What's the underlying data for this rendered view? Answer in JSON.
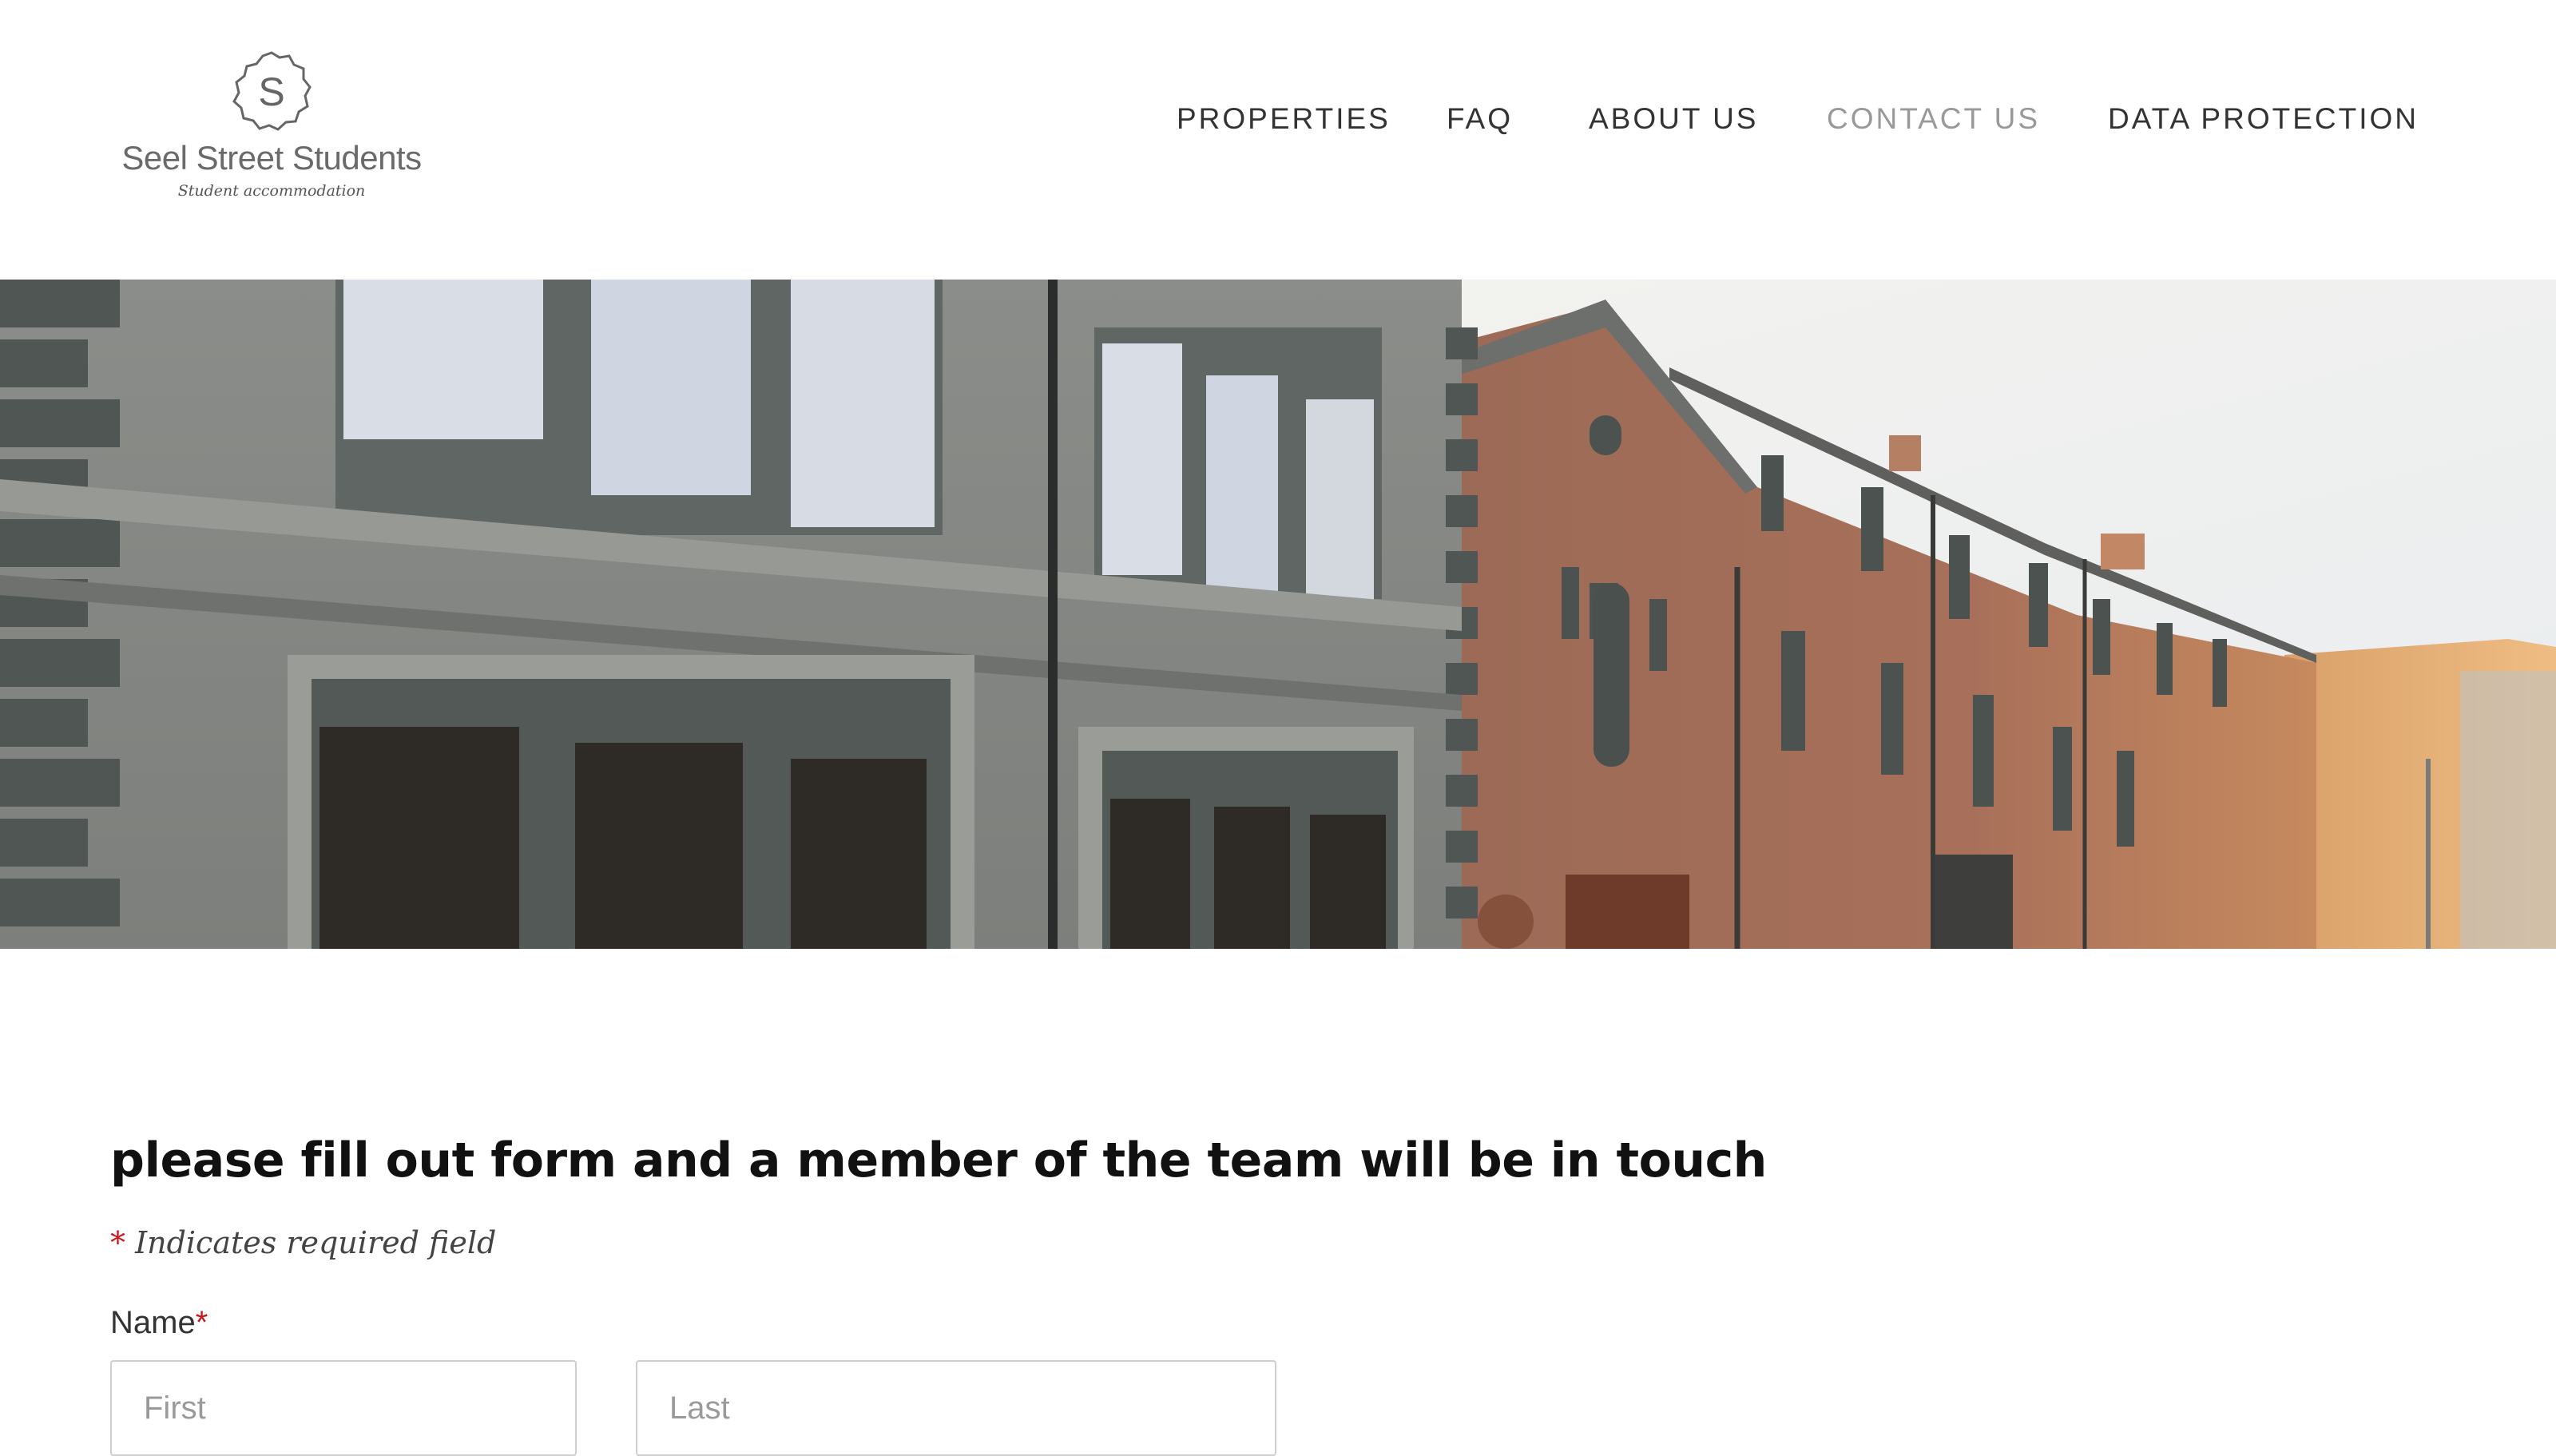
{
  "header": {
    "logo": {
      "monogram": "S",
      "name": "Seel Street Students",
      "tagline": "Student accommodation"
    },
    "nav": [
      {
        "label": "PROPERTIES",
        "active": false
      },
      {
        "label": "FAQ",
        "active": false
      },
      {
        "label": "ABOUT US",
        "active": false
      },
      {
        "label": "CONTACT US",
        "active": true
      },
      {
        "label": "DATA PROTECTION",
        "active": false
      }
    ]
  },
  "hero": {
    "image": "street-of-terraced-buildings-photo"
  },
  "form": {
    "title": "please fill out form and a member of the team will be in touch",
    "required_marker": "*",
    "required_note": "Indicates required field",
    "name_label": "Name",
    "first_placeholder": "First",
    "last_placeholder": "Last"
  },
  "colors": {
    "nav_text": "#333333",
    "nav_active": "#999999",
    "required_star": "#c8161d",
    "title_text": "#111111"
  }
}
